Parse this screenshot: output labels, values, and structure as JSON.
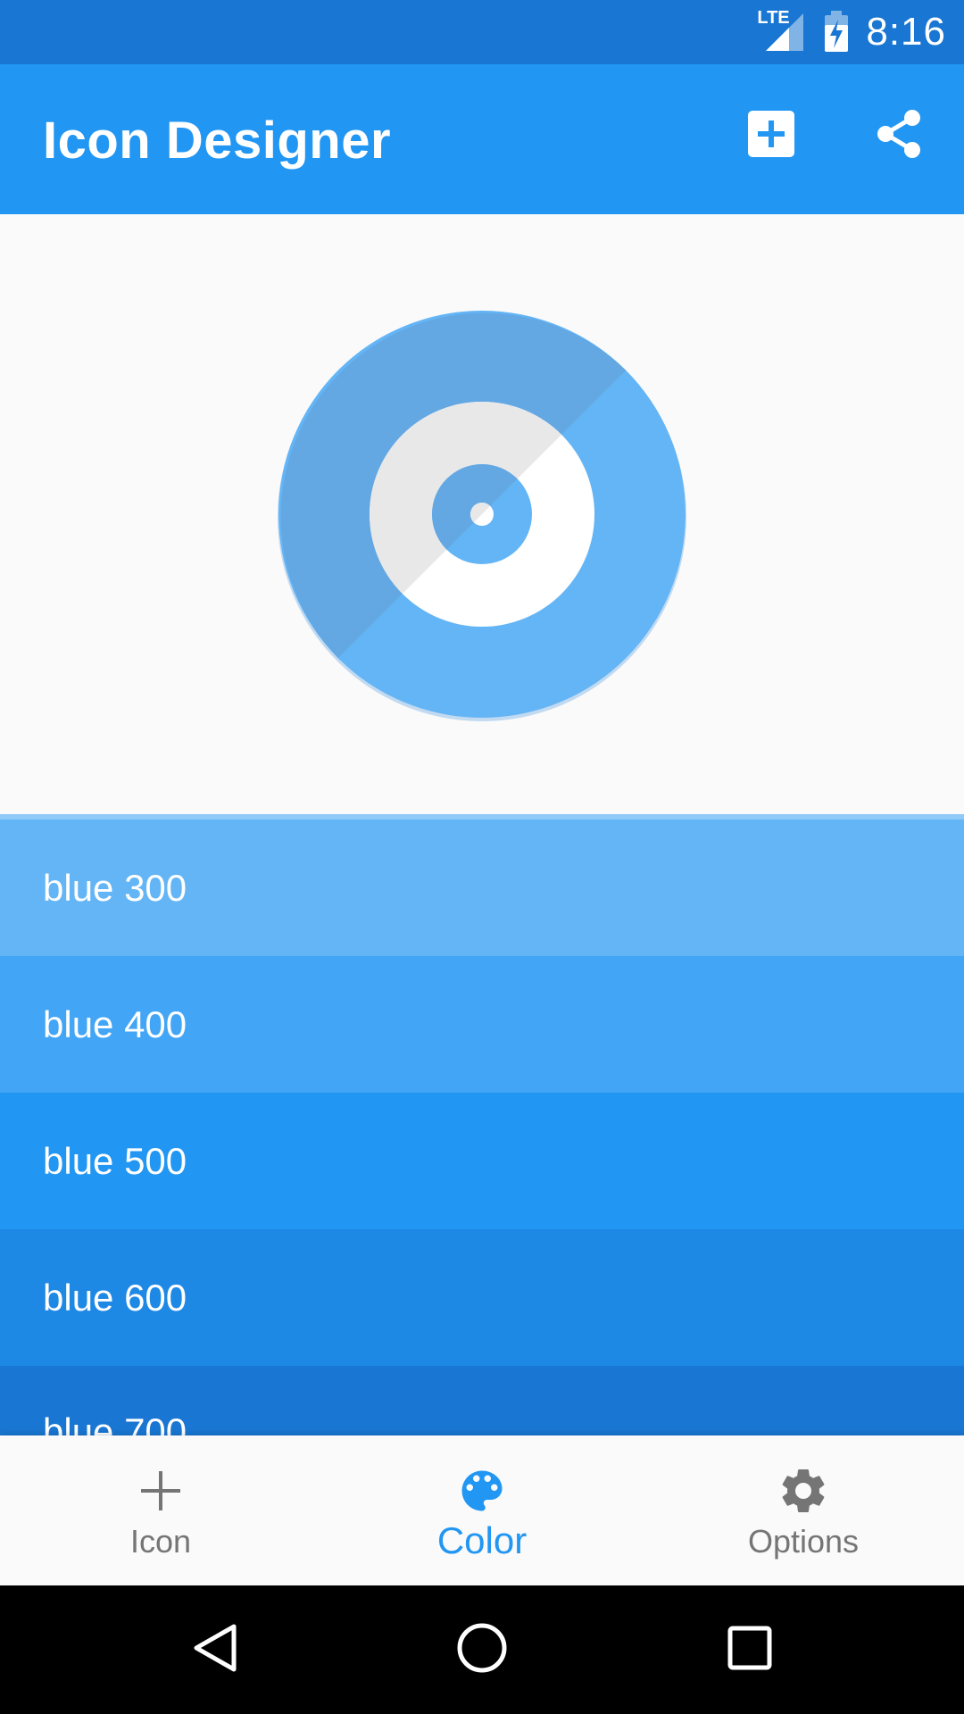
{
  "status_bar": {
    "network": "LTE",
    "time": "8:16"
  },
  "app_bar": {
    "title": "Icon Designer",
    "actions": [
      {
        "icon": "add-box-icon"
      },
      {
        "icon": "share-icon"
      }
    ],
    "color": "#2196f3"
  },
  "preview": {
    "icon": "record-disc-icon",
    "colors": {
      "outer_light": "#64b5f6",
      "outer_dark": "#64a9e6",
      "inner_light": "#ffffff",
      "inner_dark": "#e8e8e8"
    }
  },
  "color_list": [
    {
      "label": "blue 300",
      "color": "#64b5f6"
    },
    {
      "label": "blue 400",
      "color": "#42a5f5"
    },
    {
      "label": "blue 500",
      "color": "#2196f3"
    },
    {
      "label": "blue 600",
      "color": "#1e88e5"
    },
    {
      "label": "blue 700",
      "color": "#1976d2"
    }
  ],
  "bottom_nav": {
    "items": [
      {
        "label": "Icon",
        "icon": "plus-icon",
        "active": false
      },
      {
        "label": "Color",
        "icon": "palette-icon",
        "active": true
      },
      {
        "label": "Options",
        "icon": "gear-icon",
        "active": false
      }
    ],
    "active_color": "#2196f3",
    "inactive_color": "#757575"
  },
  "system_nav": {
    "buttons": [
      "back-icon",
      "home-icon",
      "recents-icon"
    ]
  }
}
